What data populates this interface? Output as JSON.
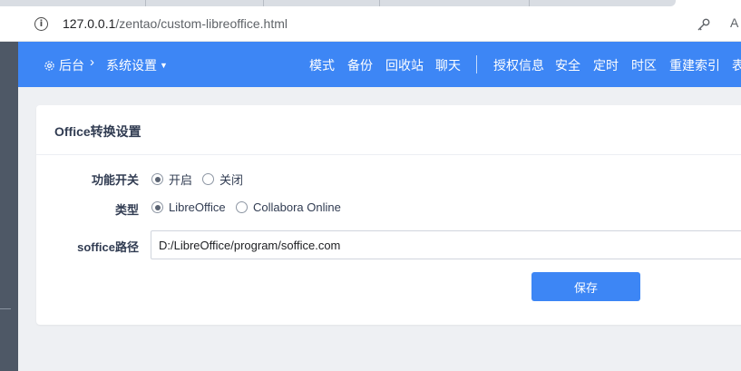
{
  "browser": {
    "url_host": "127.0.0.1",
    "url_path": "/zentao/custom-libreoffice.html",
    "reader_label": "A"
  },
  "nav": {
    "back_label": "后台",
    "crumb_sep": "›",
    "settings_label": "系统设置",
    "links": [
      "模式",
      "备份",
      "回收站",
      "聊天",
      "授权信息",
      "安全",
      "定时",
      "时区",
      "重建索引",
      "表"
    ]
  },
  "card": {
    "title": "Office转换设置",
    "enable": {
      "label": "功能开关",
      "options": [
        "开启",
        "关闭"
      ],
      "selected": "开启"
    },
    "type": {
      "label": "类型",
      "options": [
        "LibreOffice",
        "Collabora Online"
      ],
      "selected": "LibreOffice"
    },
    "soffice": {
      "label": "soffice路径",
      "value": "D:/LibreOffice/program/soffice.com"
    },
    "save_label": "保存"
  },
  "colors": {
    "primary": "#3d86f5",
    "sidebar": "#4e5866",
    "page_bg": "#eef0f3"
  }
}
